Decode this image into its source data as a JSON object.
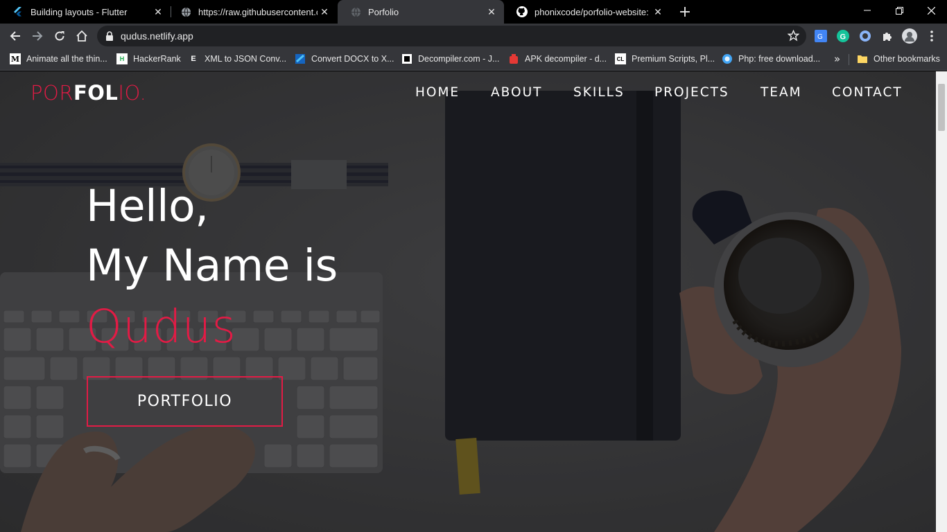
{
  "browser": {
    "tabs": [
      {
        "title": "Building layouts - Flutter",
        "icon": "flutter-icon"
      },
      {
        "title": "https://raw.githubusercontent.co",
        "icon": "globe-icon"
      },
      {
        "title": "Porfolio",
        "icon": "globe-icon",
        "active": true
      },
      {
        "title": "phonixcode/porfolio-website: My",
        "icon": "github-icon"
      }
    ],
    "new_tab_label": "+",
    "url": "qudus.netlify.app",
    "bookmarks": [
      {
        "label": "Animate all the thin...",
        "icon_text": "M"
      },
      {
        "label": "HackerRank",
        "icon_text": "H"
      },
      {
        "label": "XML to JSON Conv...",
        "icon_text": "E"
      },
      {
        "label": "Convert DOCX to X...",
        "icon_text": ""
      },
      {
        "label": "Decompiler.com - J...",
        "icon_text": ""
      },
      {
        "label": "APK decompiler - d...",
        "icon_text": ""
      },
      {
        "label": "Premium Scripts, Pl...",
        "icon_text": "CL"
      },
      {
        "label": "Php: free download...",
        "icon_text": ""
      }
    ],
    "bookmarks_overflow": "»",
    "other_bookmarks": "Other bookmarks"
  },
  "site": {
    "logo_a": "POR",
    "logo_b": "FOL",
    "logo_c": "IO.",
    "nav": [
      "HOME",
      "ABOUT",
      "SKILLS",
      "PROJECTS",
      "TEAM",
      "CONTACT"
    ],
    "hero_line1": "Hello,",
    "hero_line2": "My Name is",
    "hero_name": "Qudus",
    "cta_label": "PORTFOLIO"
  },
  "colors": {
    "accent": "#e21b45",
    "tab_active": "#35363a",
    "omnibox": "#202124"
  }
}
